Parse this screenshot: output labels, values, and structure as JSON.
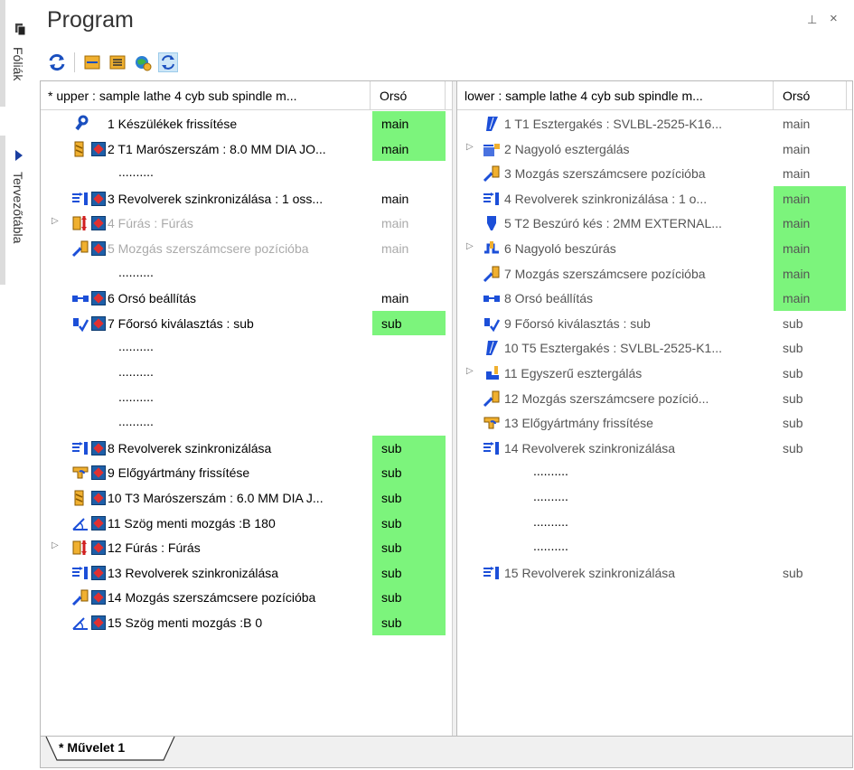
{
  "side_tabs": {
    "top": "Fóliák",
    "bottom": "Tervezőtábla"
  },
  "title": "Program",
  "window_buttons": {
    "pin": "⊥",
    "close": "×"
  },
  "toolbar": [
    "refresh-icon",
    "stock-icon",
    "list-icon",
    "globe-settings-icon",
    "sync-icon"
  ],
  "upper": {
    "header_name": "* upper : sample lathe 4 cyb sub spindle m...",
    "header_orso": "Orsó",
    "rows": [
      {
        "label": "1 Készülékek frissítése",
        "orso": "main",
        "green": true,
        "icon": "wrench-icon",
        "badge": false
      },
      {
        "label": "2 T1 Marószerszám : 8.0 MM DIA JO...",
        "orso": "main",
        "green": true,
        "icon": "mill-tool-icon",
        "badge": true
      },
      {
        "label": "..........",
        "orso": "",
        "green": false,
        "dots": true
      },
      {
        "label": "3 Revolverek szinkronizálása : 1 oss...",
        "orso": "main",
        "green": false,
        "icon": "sync-turret-icon",
        "badge": true
      },
      {
        "label": "4 Fúrás : Fúrás",
        "orso": "main",
        "green": false,
        "icon": "drill-icon",
        "badge": true,
        "disabled": true,
        "expand": true
      },
      {
        "label": "5 Mozgás szerszámcsere pozícióba",
        "orso": "main",
        "green": false,
        "icon": "tool-change-move-icon",
        "badge": true,
        "disabled": true
      },
      {
        "label": "..........",
        "orso": "",
        "green": false,
        "dots": true
      },
      {
        "label": "6 Orsó beállítás",
        "orso": "main",
        "green": false,
        "icon": "spindle-icon",
        "badge": true
      },
      {
        "label": "7 Főorsó kiválasztás : sub",
        "orso": "sub",
        "green": true,
        "icon": "spindle-select-icon",
        "badge": true
      },
      {
        "label": "..........",
        "orso": "",
        "green": false,
        "dots": true
      },
      {
        "label": "..........",
        "orso": "",
        "green": false,
        "dots": true
      },
      {
        "label": "..........",
        "orso": "",
        "green": false,
        "dots": true
      },
      {
        "label": "..........",
        "orso": "",
        "green": false,
        "dots": true
      },
      {
        "label": "8 Revolverek szinkronizálása",
        "orso": "sub",
        "green": true,
        "icon": "sync-turret-icon",
        "badge": true
      },
      {
        "label": "9 Előgyártmány frissítése",
        "orso": "sub",
        "green": true,
        "icon": "stock-update-icon",
        "badge": true
      },
      {
        "label": "10 T3 Marószerszám : 6.0 MM DIA J...",
        "orso": "sub",
        "green": true,
        "icon": "mill-tool-icon",
        "badge": true
      },
      {
        "label": "11 Szög menti mozgás :B 180",
        "orso": "sub",
        "green": true,
        "icon": "angle-move-icon",
        "badge": true
      },
      {
        "label": "12 Fúrás : Fúrás",
        "orso": "sub",
        "green": true,
        "icon": "drill-icon",
        "badge": true,
        "expand": true
      },
      {
        "label": "13 Revolverek szinkronizálása",
        "orso": "sub",
        "green": true,
        "icon": "sync-turret-icon",
        "badge": true
      },
      {
        "label": "14 Mozgás szerszámcsere pozícióba",
        "orso": "sub",
        "green": true,
        "icon": "tool-change-move-icon",
        "badge": true
      },
      {
        "label": "15 Szög menti mozgás :B 0",
        "orso": "sub",
        "green": true,
        "icon": "angle-move-icon",
        "badge": true
      }
    ]
  },
  "lower": {
    "header_name": "lower : sample lathe 4 cyb sub spindle m...",
    "header_orso": "Orsó",
    "rows": [
      {
        "label": "1 T1 Esztergakés : SVLBL-2525-K16...",
        "orso": "main",
        "green": false,
        "icon": "turning-tool-icon"
      },
      {
        "label": "2 Nagyoló esztergálás",
        "orso": "main",
        "green": false,
        "icon": "rough-turning-icon",
        "expand": true
      },
      {
        "label": "3 Mozgás szerszámcsere pozícióba",
        "orso": "main",
        "green": false,
        "icon": "tool-change-move-icon"
      },
      {
        "label": "4 Revolverek szinkronizálása : 1 o...",
        "orso": "main",
        "green": true,
        "icon": "sync-turret-icon"
      },
      {
        "label": "5 T2 Beszúró kés : 2MM EXTERNAL...",
        "orso": "main",
        "green": true,
        "icon": "groove-tool-icon"
      },
      {
        "label": "6 Nagyoló beszúrás",
        "orso": "main",
        "green": true,
        "icon": "rough-groove-icon",
        "expand": true
      },
      {
        "label": "7 Mozgás szerszámcsere pozícióba",
        "orso": "main",
        "green": true,
        "icon": "tool-change-move-icon"
      },
      {
        "label": "8 Orsó beállítás",
        "orso": "main",
        "green": true,
        "icon": "spindle-icon"
      },
      {
        "label": "9 Főorsó kiválasztás : sub",
        "orso": "sub",
        "green": false,
        "icon": "spindle-select-icon"
      },
      {
        "label": "10 T5 Esztergakés : SVLBL-2525-K1...",
        "orso": "sub",
        "green": false,
        "icon": "turning-tool-icon"
      },
      {
        "label": "11 Egyszerű esztergálás",
        "orso": "sub",
        "green": false,
        "icon": "simple-turning-icon",
        "expand": true
      },
      {
        "label": "12 Mozgás szerszámcsere pozíció...",
        "orso": "sub",
        "green": false,
        "icon": "tool-change-move-icon"
      },
      {
        "label": "13 Előgyártmány frissítése",
        "orso": "sub",
        "green": false,
        "icon": "stock-update-icon"
      },
      {
        "label": "14 Revolverek szinkronizálása",
        "orso": "sub",
        "green": false,
        "icon": "sync-turret-icon"
      },
      {
        "label": "..........",
        "orso": "",
        "green": false,
        "dots": true
      },
      {
        "label": "..........",
        "orso": "",
        "green": false,
        "dots": true
      },
      {
        "label": "..........",
        "orso": "",
        "green": false,
        "dots": true
      },
      {
        "label": "..........",
        "orso": "",
        "green": false,
        "dots": true
      },
      {
        "label": "15 Revolverek szinkronizálása",
        "orso": "sub",
        "green": false,
        "icon": "sync-turret-icon"
      }
    ]
  },
  "bottom_tab": "* Művelet 1",
  "colors": {
    "green": "#7cf47c",
    "badge_blue": "#1e5fa8",
    "badge_red": "#e03030",
    "tool_yellow": "#f0b030",
    "tool_blue": "#1c4fd8"
  }
}
